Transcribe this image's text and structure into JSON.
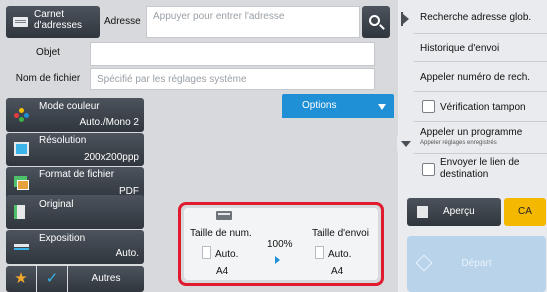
{
  "address_bar": {
    "carnet_label": "Carnet d'adresses",
    "adresse_label": "Adresse",
    "adresse_placeholder": "Appuyer pour entrer l'adresse"
  },
  "fields": {
    "objet_label": "Objet",
    "objet_value": "",
    "fichier_label": "Nom de fichier",
    "fichier_placeholder": "Spécifié par les réglages système"
  },
  "options_label": "Options",
  "right_panel": {
    "items": [
      {
        "label": "Recherche adresse glob."
      },
      {
        "label": "Historique d'envoi"
      },
      {
        "label": "Appeler numéro de rech."
      },
      {
        "label": "Vérification tampon"
      },
      {
        "label": "Appeler un programme",
        "sub": "Appeler réglages enregistrés"
      },
      {
        "label": "Envoyer le lien de destination"
      }
    ],
    "apercu_label": "Aperçu",
    "ca_label": "CA",
    "depart_label": "Départ"
  },
  "modes": [
    {
      "title": "Mode couleur",
      "value": "Auto./Mono 2"
    },
    {
      "title": "Résolution",
      "value": "200x200ppp"
    },
    {
      "title": "Format de fichier",
      "value": "PDF"
    },
    {
      "title": "Original",
      "value": ""
    },
    {
      "title": "Exposition",
      "value": "Auto."
    }
  ],
  "bottom_left": {
    "star": "★",
    "check": "✓",
    "autres_label": "Autres"
  },
  "size_panel": {
    "scan_title": "Taille de num.",
    "scan_value": "Auto.",
    "scan_paper": "A4",
    "ratio": "100%",
    "send_title": "Taille d'envoi",
    "send_value": "Auto.",
    "send_paper": "A4"
  },
  "colors": {
    "accent_blue": "#1f8fd6",
    "highlight_red": "#e01b2f",
    "ca_yellow": "#f5b800"
  }
}
